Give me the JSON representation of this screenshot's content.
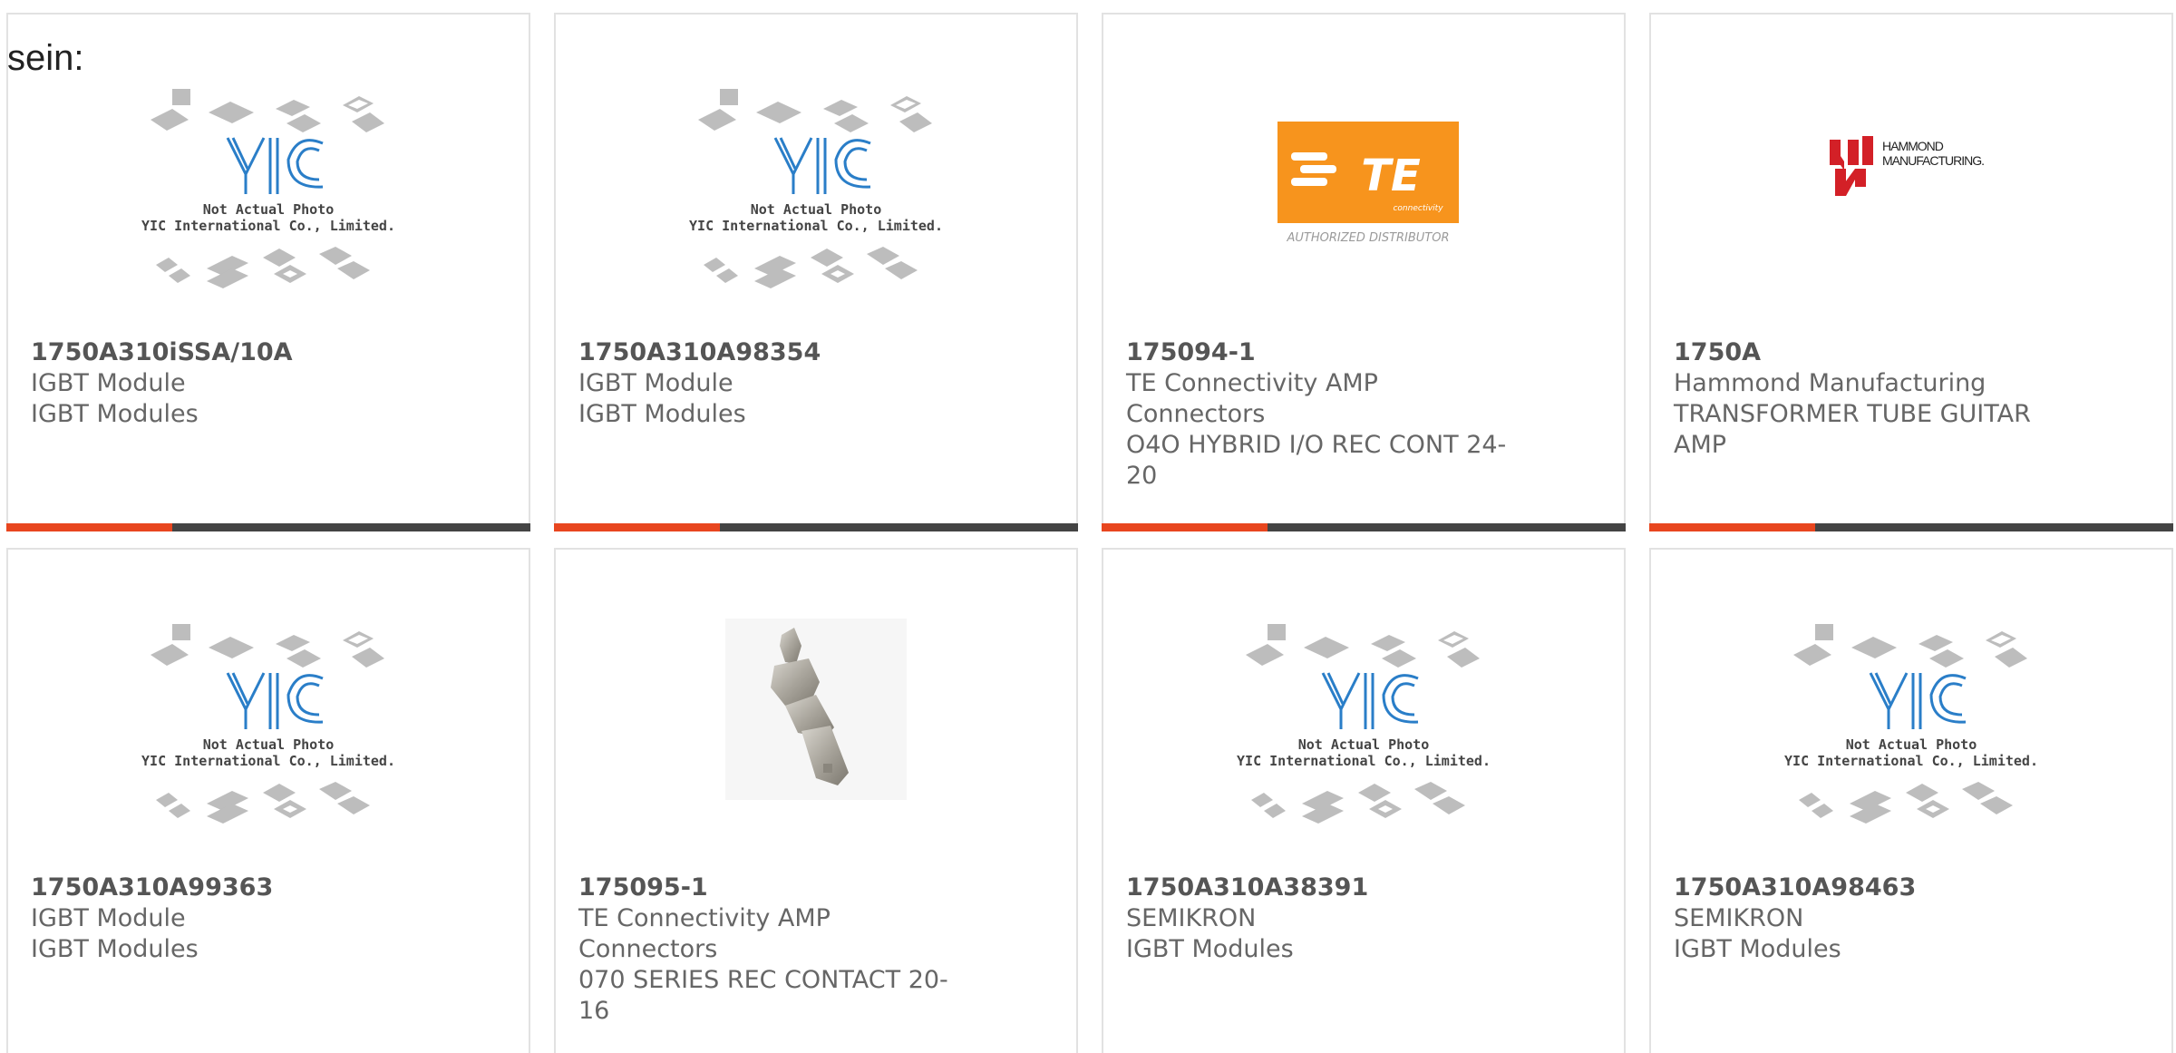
{
  "intro_text": "sein:",
  "brand": {
    "accent": "#e8461f",
    "bar": "#444444",
    "te_orange": "#f7941d",
    "hammond_red": "#d32027",
    "yic_blue": "#2a7ec8"
  },
  "placeholder": {
    "line1": "Not Actual Photo",
    "line2": "YIC International Co., Limited.",
    "logo": "YIC"
  },
  "te_logo": {
    "text": "TE",
    "sub": "connectivity",
    "caption": "AUTHORIZED DISTRIBUTOR"
  },
  "hammond_logo": {
    "line1": "HAMMOND",
    "line2": "MANUFACTURING."
  },
  "cards": [
    {
      "part": "1750A310iSSA/10A",
      "line1": "IGBT Module",
      "line2": "IGBT Modules",
      "line3": "",
      "image": "yic-placeholder"
    },
    {
      "part": "1750A310A98354",
      "line1": "IGBT Module",
      "line2": "IGBT Modules",
      "line3": "",
      "image": "yic-placeholder"
    },
    {
      "part": "175094-1",
      "line1": "TE Connectivity AMP Connectors",
      "line2": "O4O HYBRID I/O REC CONT 24-",
      "line3": "20",
      "image": "te-logo"
    },
    {
      "part": "1750A",
      "line1": "Hammond Manufacturing",
      "line2": "TRANSFORMER TUBE GUITAR",
      "line3": "AMP",
      "image": "hammond-logo"
    },
    {
      "part": "1750A310A99363",
      "line1": "IGBT Module",
      "line2": "IGBT Modules",
      "line3": "",
      "image": "yic-placeholder"
    },
    {
      "part": "175095-1",
      "line1": "TE Connectivity AMP Connectors",
      "line2": "070 SERIES REC CONTACT 20-16",
      "line3": "",
      "image": "connector-photo"
    },
    {
      "part": "1750A310A38391",
      "line1": "SEMIKRON",
      "line2": "IGBT Modules",
      "line3": "",
      "image": "yic-placeholder"
    },
    {
      "part": "1750A310A98463",
      "line1": "SEMIKRON",
      "line2": "IGBT Modules",
      "line3": "",
      "image": "yic-placeholder"
    }
  ]
}
